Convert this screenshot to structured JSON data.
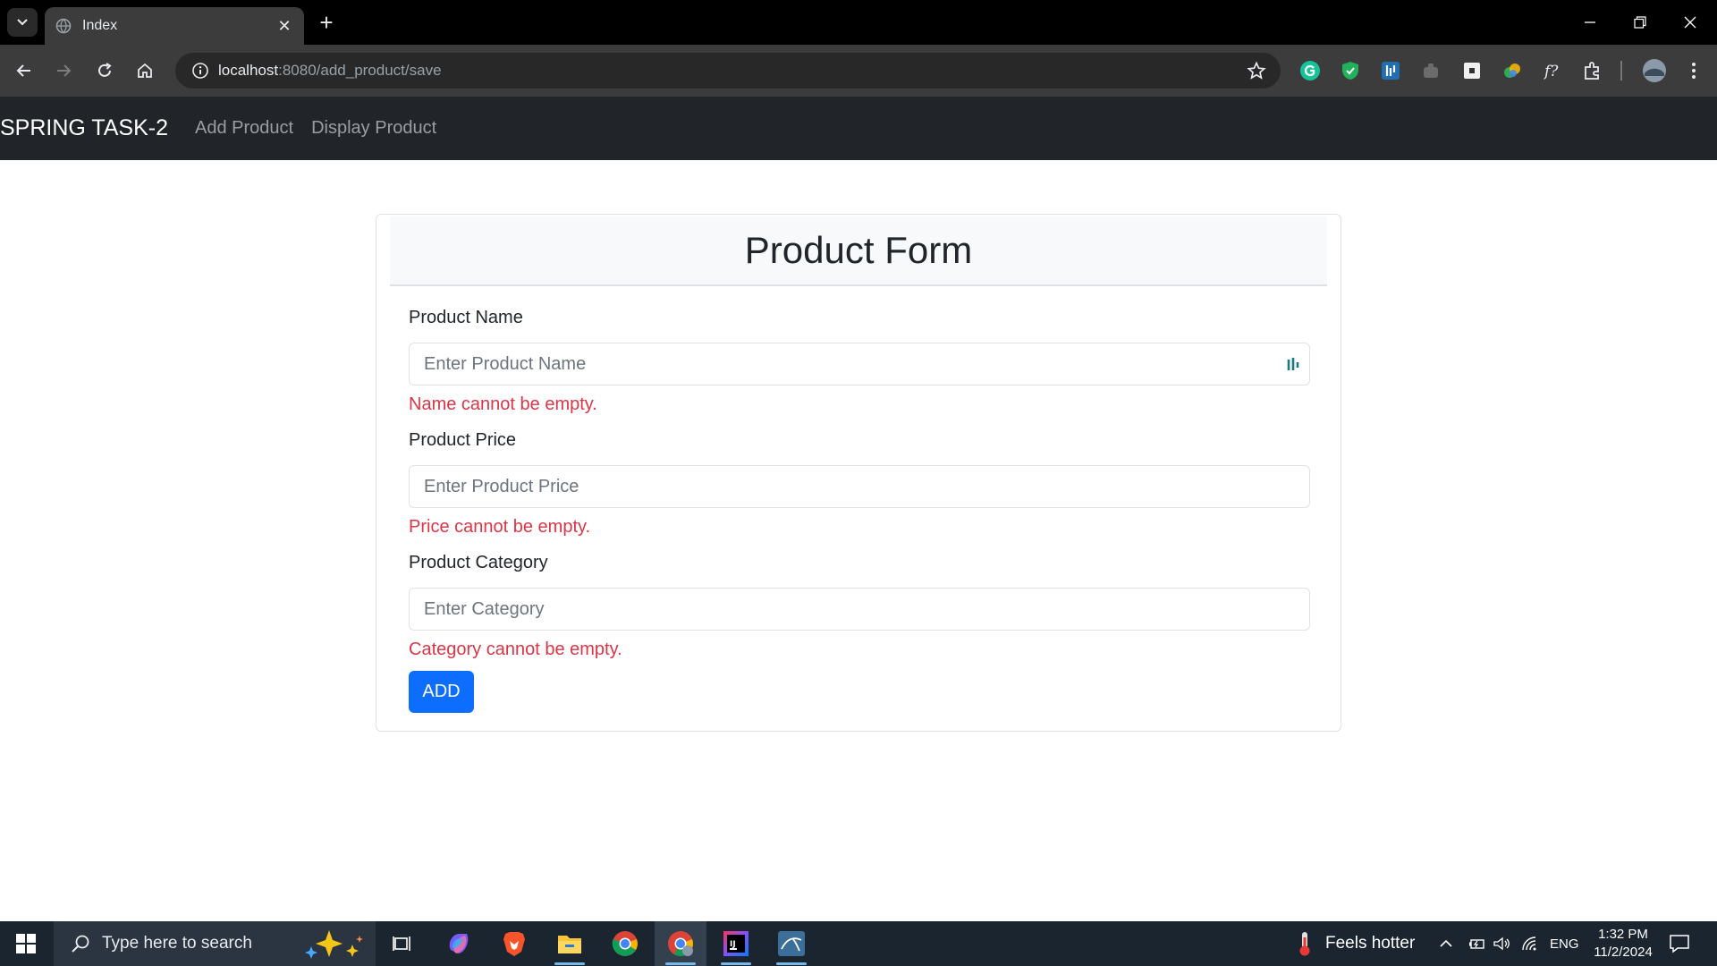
{
  "browser": {
    "tab_title": "Index",
    "url_host": "localhost",
    "url_rest": ":8080/add_product/save"
  },
  "navbar": {
    "brand": "SPRING TASK-2",
    "links": [
      "Add Product",
      "Display Product"
    ]
  },
  "form": {
    "title": "Product Form",
    "fields": [
      {
        "label": "Product Name",
        "placeholder": "Enter Product Name",
        "value": "",
        "error": "Name cannot be empty."
      },
      {
        "label": "Product Price",
        "placeholder": "Enter Product Price",
        "value": "",
        "error": "Price cannot be empty."
      },
      {
        "label": "Product Category",
        "placeholder": "Enter Category",
        "value": "",
        "error": "Category cannot be empty."
      }
    ],
    "submit_label": "ADD"
  },
  "taskbar": {
    "search_placeholder": "Type here to search",
    "weather": "Feels hotter",
    "language": "ENG",
    "time": "1:32 PM",
    "date": "11/2/2024"
  },
  "colors": {
    "navbar_bg": "#212529",
    "primary": "#0d6efd",
    "error": "#dc3545"
  }
}
